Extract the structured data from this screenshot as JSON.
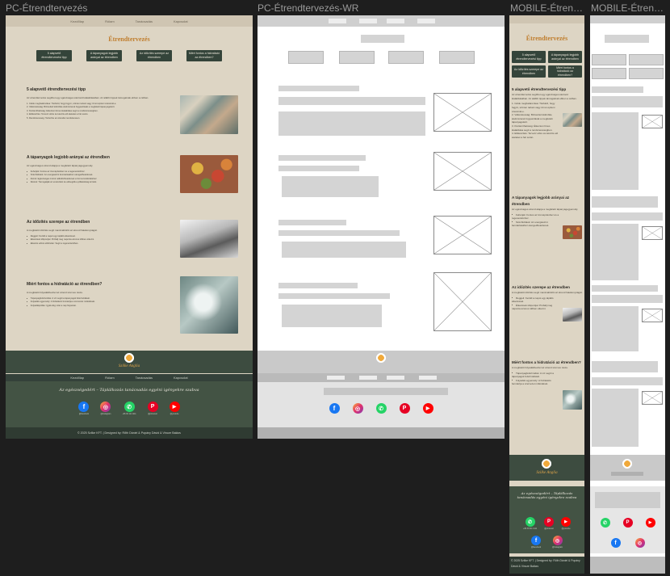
{
  "frames": {
    "pc": "PC-Étrendtervezés",
    "pc_wr": "PC-Étrendtervezés-WR",
    "mobile": "MOBILE-Étren…",
    "mobile_wr": "MOBILE-Étren…"
  },
  "site": {
    "nav": [
      "Kezdőlap",
      "Rólam",
      "Tanácsadás",
      "Kapcsolat"
    ],
    "title": "Étrendtervezés",
    "buttons": [
      "5 alapvető étrendtervezési tipp",
      "A tápanyagok legjobb arányai az étrendben",
      "Az időzítés szerepe az étrendben",
      "Miért fontos a hidratáció az étrendben?"
    ],
    "sections": [
      {
        "heading": "5 alapvető étrendtervezési tipp",
        "intro": "Az étrendtervezés segíthet egy egészséges életmód kialakításában. Az alábbi tippek támogatnak ebben a célban.",
        "items": [
          "Célok meghatározása: Tisztázd, hogy fogyni, szinten tartani vagy izmot építeni szeretnél-e.",
          "Változatosság: Biztosítsd különféle élelmiszerek fogyasztását a megfelelő tápanyagokért.",
          "Kiszámíthatóság: Étkezési ritmus kialakítása segít a rendszerességben.",
          "Előkészítés: Tervezz előre és készíts elő ételeket a hét során.",
          "Rendszeresség: Tartsd be az étrendet rendszeresen."
        ]
      },
      {
        "heading": "A tápanyagok legjobb arányai az étrendben",
        "intro": "Az egészséges étrend alapja a megfelelő tápanyagegyensúly.",
        "items": [
          "Fehérjék: Fontos az izomépítéshez és a regenerációhoz.",
          "Szénhidrátok: Az energiaszint fenntartásához elengedhetetlenek.",
          "Zsírok: Egészséges zsírok nélkülözhetetlenek a hormonműködéshez.",
          "Rostok: Támogatják az emésztést és elősegítik a jóllakottság érzetét."
        ]
      },
      {
        "heading": "Az időzítés szerepe az étrendben",
        "intro": "A megfelelő időzítés segít maximalizálni az étrend hatékonyságát.",
        "items": [
          "Reggeli: Kezdd a napot egy tápláló étkezéssel.",
          "Étkezések időpontjai: Próbálj meg naponta azonos időben étkezni.",
          "Étkezés edzés előtt/után: Segít a regenerációban."
        ]
      },
      {
        "heading": "Miért fontos a hidratáció az étrendben?",
        "intro": "A megfelelő folyadékbevitel az étrend szerves része.",
        "items": [
          "Tápanyagfelszívódás: A víz segíti a tápanyagok felszívódását.",
          "Folyadék egyensúly: A hidratáció fenntartja a szervezet működését.",
          "Folyadékpótlás: Igyál elég vizet a nap folyamán."
        ]
      }
    ],
    "logo_text": "Szilke Anglia",
    "tagline": "Az egészségedért – Táplálkozás tanácsadás egyéni igényekre szabva",
    "socials": [
      {
        "name": "facebook",
        "caption": "@facebook",
        "glyph": "f"
      },
      {
        "name": "instagram",
        "caption": "@instagram",
        "glyph": "◎"
      },
      {
        "name": "whatsapp",
        "caption": "+36 30 111 1111",
        "glyph": "✆"
      },
      {
        "name": "pinterest",
        "caption": "@pinterest",
        "glyph": "P"
      },
      {
        "name": "youtube",
        "caption": "@youtube",
        "glyph": "▶"
      }
    ],
    "copyright": "© 2025 Szilke KFT. | Designed by: Rőth Dániel & Popány Dávid & Vincze Balázs",
    "copyright_mobile": "© 2025 Szilke KFT. | Designed by: Rőth Dániel & Popány Dávid & Vincze Balázs"
  },
  "colors": {
    "beige": "#ddd5c4",
    "dark_green": "#3d4c40",
    "accent_orange": "#c07e2e",
    "wire_gray": "#d4d4d4"
  }
}
